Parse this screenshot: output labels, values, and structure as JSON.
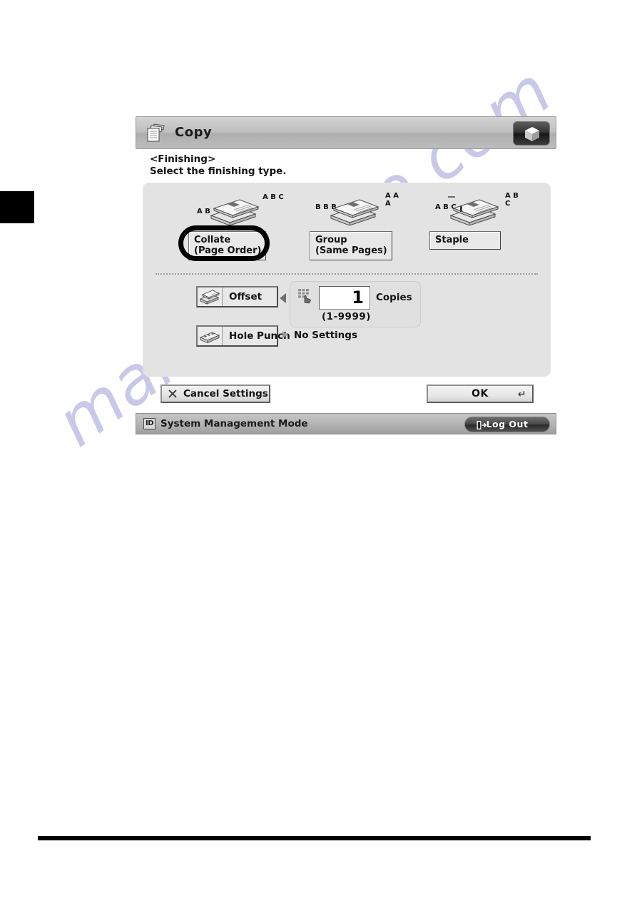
{
  "page": {
    "chapter_tab": "",
    "watermark": "manualshive.com"
  },
  "screen": {
    "titlebar": {
      "icon": "copy-documents-icon",
      "title": "Copy",
      "right_button_icon": "cube-icon"
    },
    "instructions": {
      "context": "<Finishing>",
      "prompt": "Select the finishing type."
    },
    "finishing_options": [
      {
        "id": "collate",
        "label": "Collate\n(Page Order)",
        "selected": true,
        "art_icon": "paper-stack-icon",
        "letters_left": "A\nB",
        "letters_right": "A\nB\nC",
        "has_staple_mark": false
      },
      {
        "id": "group",
        "label": "Group\n(Same Pages)",
        "selected": false,
        "art_icon": "paper-stack-icon",
        "letters_left": "B\nB\nB",
        "letters_right": "A\nA\nA",
        "has_staple_mark": false
      },
      {
        "id": "staple",
        "label": "Staple",
        "selected": false,
        "art_icon": "paper-stack-stapled-icon",
        "letters_left": "A\nB\nC",
        "letters_right": "A\nB\nC",
        "has_staple_mark": true
      }
    ],
    "offset": {
      "label": "Offset",
      "icon": "offset-stack-icon"
    },
    "copies": {
      "keypad_icon": "numeric-keypad-icon",
      "value": "1",
      "unit_label": "Copies",
      "range": "(1-9999)"
    },
    "hole_punch": {
      "label": "Hole Punch",
      "icon": "hole-punch-icon",
      "value": "No Settings"
    },
    "actions": {
      "cancel_label": "Cancel Settings",
      "cancel_icon": "close-x-icon",
      "ok_label": "OK",
      "ok_glyph": "↵"
    },
    "statusbar": {
      "badge": "ID",
      "text": "System Management Mode",
      "logout_label": "Log Out",
      "logout_icon": "logout-arrow-icon"
    }
  },
  "colors": {
    "panel_bg": "#e3e3e3",
    "titlebar": "#bdbdbd",
    "selection_ring": "#000000",
    "watermark": "#c9c8e8",
    "text": "#121212"
  }
}
